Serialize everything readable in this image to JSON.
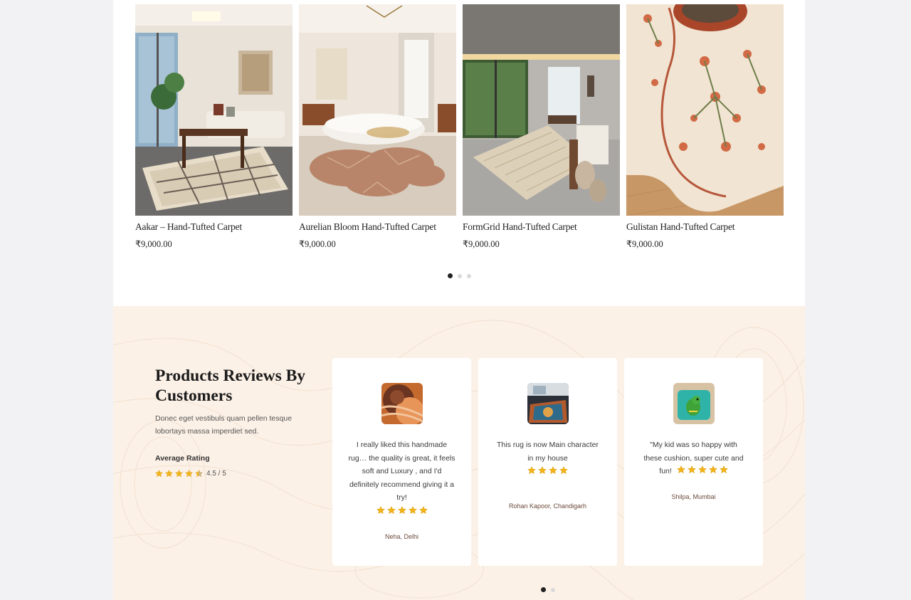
{
  "products": [
    {
      "name": "Aakar – Hand-Tufted Carpet",
      "price": "₹9,000.00"
    },
    {
      "name": "Aurelian Bloom Hand-Tufted Carpet",
      "price": "₹9,000.00"
    },
    {
      "name": "FormGrid Hand-Tufted Carpet",
      "price": "₹9,000.00"
    },
    {
      "name": "Gulistan Hand-Tufted Carpet",
      "price": "₹9,000.00"
    }
  ],
  "product_carousel": {
    "pages": 3,
    "active": 0
  },
  "reviews": {
    "title": "Products Reviews By Customers",
    "subtitle": "Donec eget vestibuls quam pellen tesque lobortays massa imperdiet sed.",
    "average_label": "Average Rating",
    "average_value": "4.5 / 5",
    "average_stars": 4.5,
    "items": [
      {
        "text": "I really liked this handmade rug… the quality is great, it feels soft and Luxury , and I'd definitely recommend giving it a try!",
        "stars": 5,
        "author": "Neha, Delhi"
      },
      {
        "text": "This rug is now Main character in my house",
        "stars": 4,
        "author": "Rohan Kapoor, Chandigarh"
      },
      {
        "text": "\"My kid was so happy with these cushion, super cute and fun!",
        "stars": 5,
        "author": "Shilpa, Mumbai"
      }
    ],
    "carousel": {
      "pages": 2,
      "active": 0
    }
  },
  "colors": {
    "star": "#f2b418",
    "section_bg": "#fcf1e7",
    "accent_text": "#6b4a3a"
  }
}
